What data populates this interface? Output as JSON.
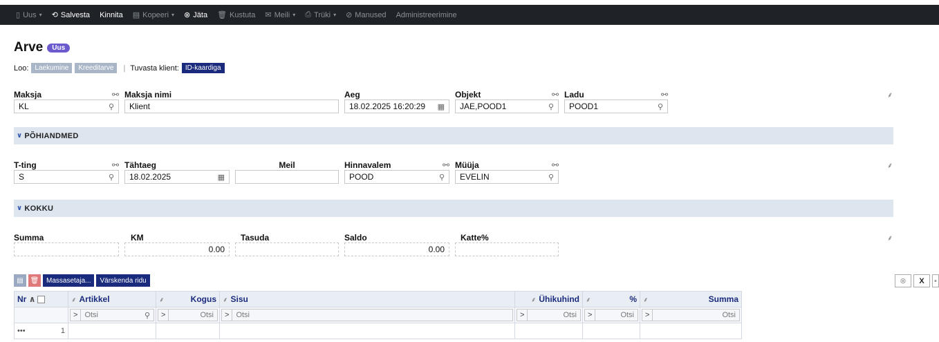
{
  "toolbar": {
    "items": [
      {
        "icon": "new-doc-icon",
        "glyph": "▯",
        "label": "Uus",
        "caret": true,
        "enabled": false
      },
      {
        "icon": "save-cloud-icon",
        "glyph": "⟲",
        "label": "Salvesta",
        "caret": false,
        "enabled": true
      },
      {
        "icon": "",
        "glyph": "",
        "label": "Kinnita",
        "caret": false,
        "enabled": true
      },
      {
        "icon": "copy-icon",
        "glyph": "▤",
        "label": "Kopeeri",
        "caret": true,
        "enabled": false
      },
      {
        "icon": "cancel-circle-icon",
        "glyph": "⊗",
        "label": "Jäta",
        "caret": false,
        "enabled": true
      },
      {
        "icon": "trash-icon",
        "glyph": "🗑",
        "label": "Kustuta",
        "caret": false,
        "enabled": false
      },
      {
        "icon": "mail-icon",
        "glyph": "✉",
        "label": "Meili",
        "caret": true,
        "enabled": false
      },
      {
        "icon": "print-icon",
        "glyph": "⎙",
        "label": "Trüki",
        "caret": true,
        "enabled": false
      },
      {
        "icon": "paperclip-icon",
        "glyph": "⊘",
        "label": "Manused",
        "caret": false,
        "enabled": false
      },
      {
        "icon": "",
        "glyph": "",
        "label": "Administreerimine",
        "caret": false,
        "enabled": false
      }
    ]
  },
  "header": {
    "title": "Arve",
    "status_badge": "Uus",
    "loo_label": "Loo:",
    "loo_buttons": [
      "Laekumine",
      "Kreeditarve"
    ],
    "tuvasta_label": "Tuvasta klient:",
    "id_button": "ID-kaardiga"
  },
  "top_fields": {
    "maksja": {
      "label": "Maksja",
      "value": "KL"
    },
    "maksja_nimi": {
      "label": "Maksja nimi",
      "value": "Klient"
    },
    "aeg": {
      "label": "Aeg",
      "value": "18.02.2025 16:20:29"
    },
    "objekt": {
      "label": "Objekt",
      "value": "JAE,POOD1"
    },
    "ladu": {
      "label": "Ladu",
      "value": "POOD1"
    }
  },
  "sections": {
    "pohiandmed": "PÕHIANDMED",
    "kokku": "KOKKU"
  },
  "main_fields": {
    "tting": {
      "label": "T-ting",
      "value": "S"
    },
    "tahtaeg": {
      "label": "Tähtaeg",
      "value": "18.02.2025"
    },
    "meil": {
      "label": "Meil",
      "value": ""
    },
    "hinnavalem": {
      "label": "Hinnavalem",
      "value": "POOD"
    },
    "muuja": {
      "label": "Müüja",
      "value": "EVELIN"
    }
  },
  "totals": {
    "summa": {
      "label": "Summa",
      "value": ""
    },
    "km": {
      "label": "KM",
      "value": "0.00"
    },
    "tasuda": {
      "label": "Tasuda",
      "value": ""
    },
    "saldo": {
      "label": "Saldo",
      "value": "0.00"
    },
    "katte": {
      "label": "Katte%",
      "value": ""
    }
  },
  "grid": {
    "massasetaja": "Massasetaja...",
    "varskenda": "Värskenda ridu",
    "columns": {
      "nr": "Nr",
      "artikkel": "Artikkel",
      "kogus": "Kogus",
      "sisu": "Sisu",
      "uhikuhind": "Ühikuhind",
      "protsent": "%",
      "summa": "Summa"
    },
    "filter_placeholder": "Otsi",
    "rows": [
      {
        "nr": "1",
        "menu": "•••"
      }
    ]
  }
}
